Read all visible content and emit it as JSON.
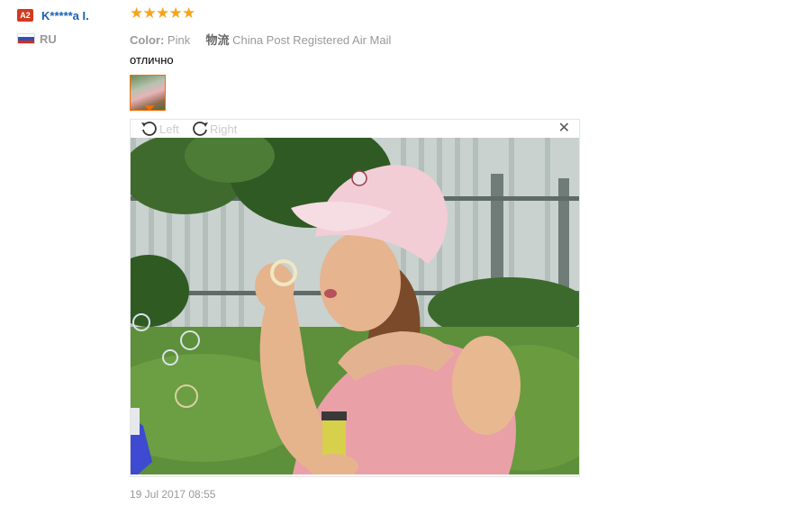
{
  "reviewer": {
    "level_badge": "A2",
    "name": "K*****a I.",
    "country_code": "RU",
    "flag": "russia-flag-icon"
  },
  "review": {
    "rating": 5,
    "rating_max": 5,
    "color_label": "Color:",
    "color_value": "Pink",
    "shipping_label": "物流",
    "shipping_value": "China Post Registered Air Mail",
    "text": "отлично",
    "timestamp": "19 Jul 2017 08:55"
  },
  "viewer": {
    "rotate_left_label": "Left",
    "rotate_right_label": "Right",
    "close_icon": "close-icon"
  },
  "colors": {
    "star": "#f7a41d",
    "user_name": "#1a61b0",
    "badge": "#d13a1f",
    "thumb_border": "#f56b00"
  }
}
